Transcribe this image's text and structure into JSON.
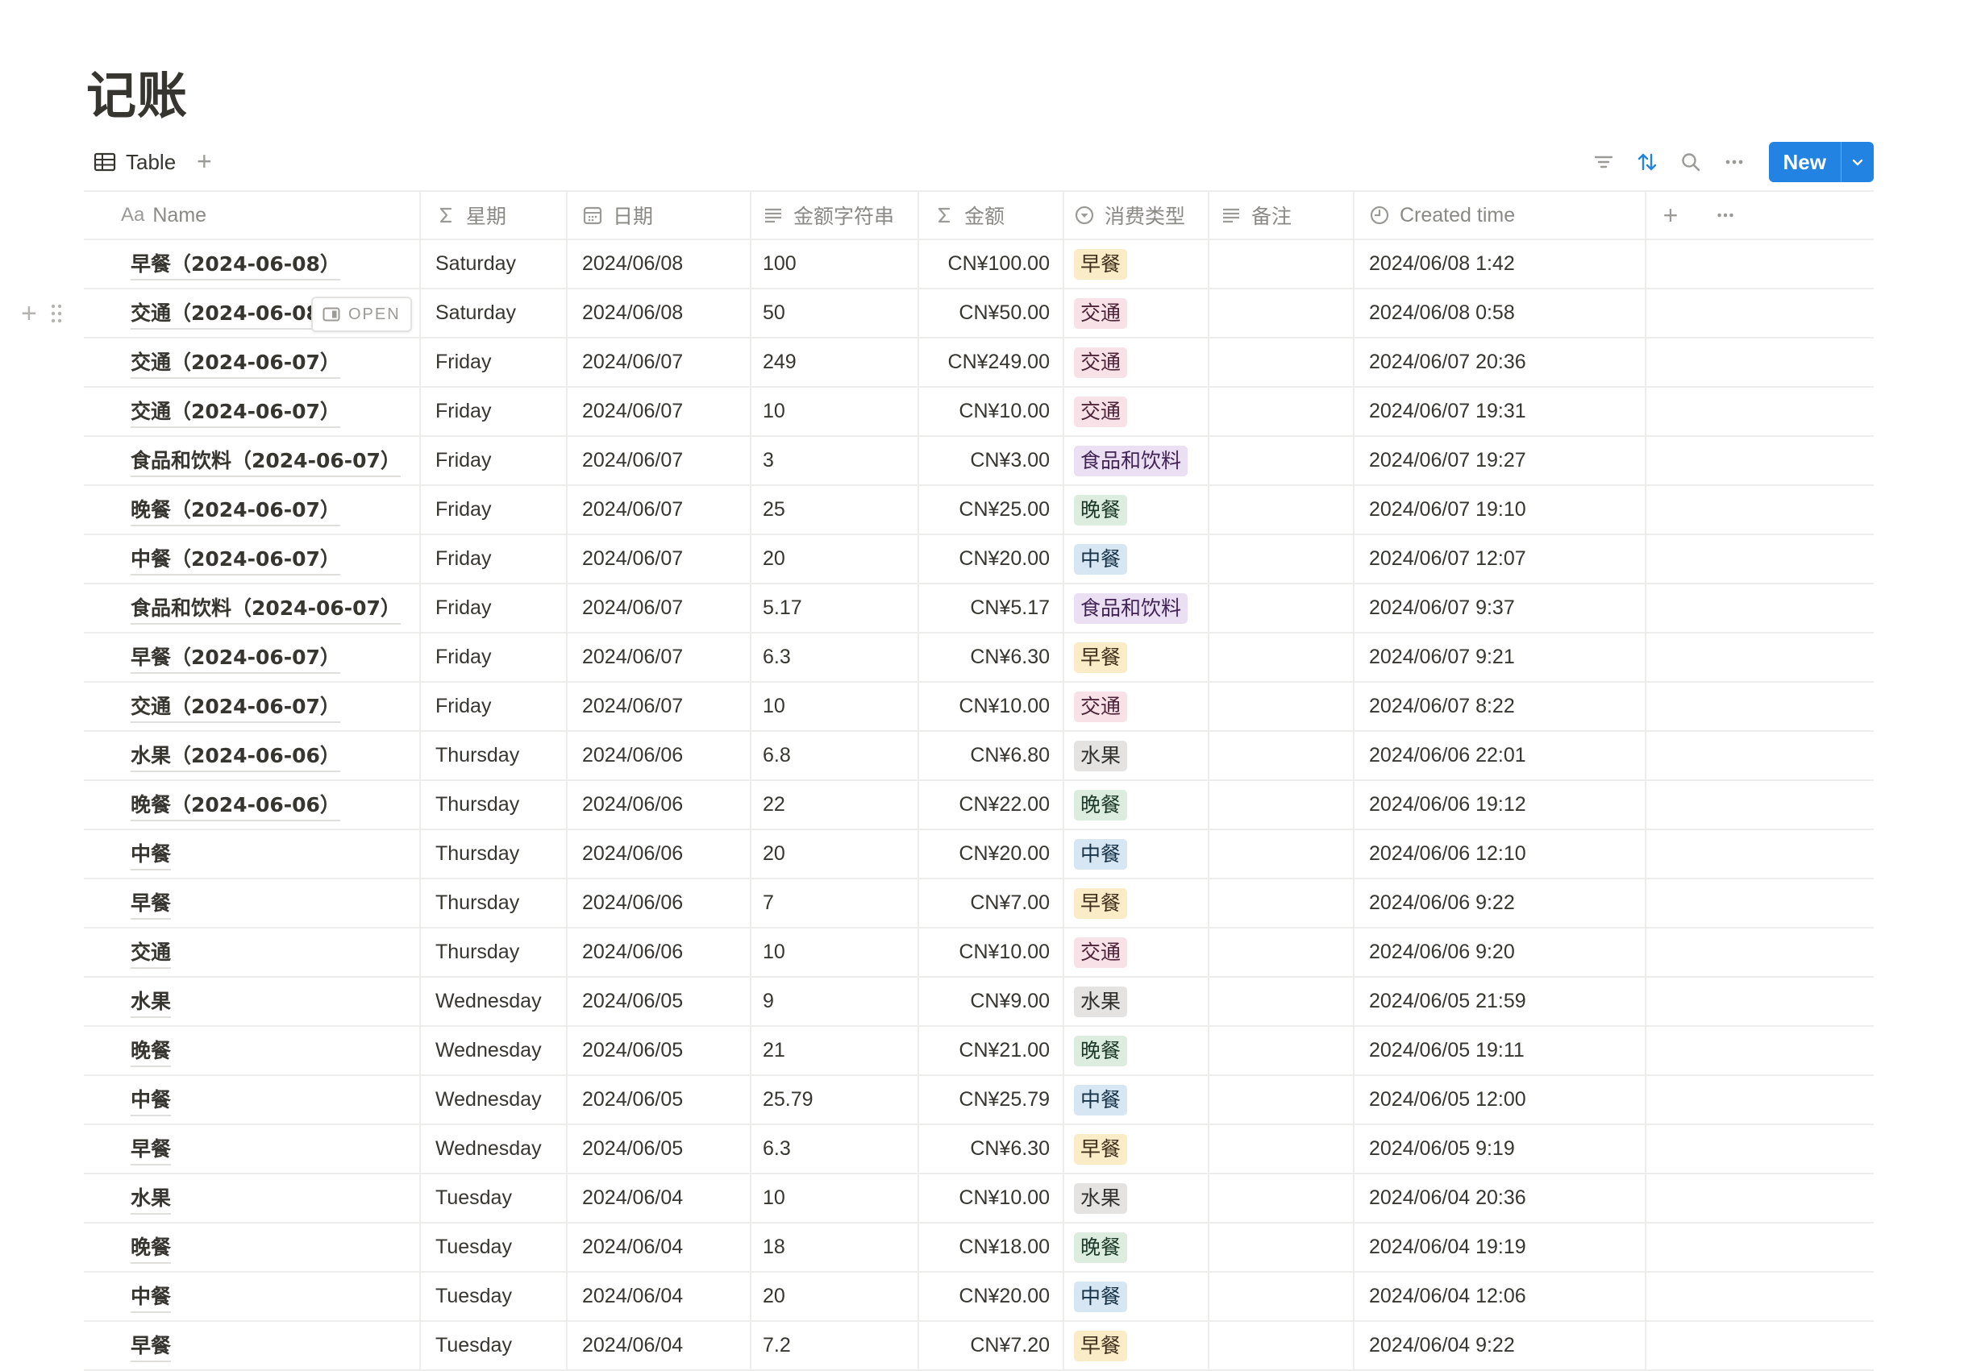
{
  "page": {
    "title": "记账"
  },
  "view": {
    "tab_label": "Table",
    "new_label": "New"
  },
  "row_hover": {
    "open_label": "OPEN"
  },
  "columns": [
    {
      "label": "Name",
      "icon": "text-aa-icon"
    },
    {
      "label": "星期",
      "icon": "sigma-icon"
    },
    {
      "label": "日期",
      "icon": "calendar-icon"
    },
    {
      "label": "金额字符串",
      "icon": "lines-icon"
    },
    {
      "label": "金额",
      "icon": "sigma-icon"
    },
    {
      "label": "消费类型",
      "icon": "select-icon"
    },
    {
      "label": "备注",
      "icon": "lines-icon"
    },
    {
      "label": "Created time",
      "icon": "clock-icon"
    }
  ],
  "column_prefix": "Aa",
  "tag_colors": {
    "早餐": {
      "bg": "#fbecc8",
      "fg": "#40301c"
    },
    "交通": {
      "bg": "#f9e1e8",
      "fg": "#4c2337"
    },
    "食品和饮料": {
      "bg": "#ebdff3",
      "fg": "#412454"
    },
    "晚餐": {
      "bg": "#dcecdf",
      "fg": "#1c3829"
    },
    "中餐": {
      "bg": "#d6e6f2",
      "fg": "#183347"
    },
    "水果": {
      "bg": "#e4e3e1",
      "fg": "#32302c"
    }
  },
  "rows": [
    {
      "name": "早餐（2024-06-08）",
      "weekday": "Saturday",
      "date": "2024/06/08",
      "amount_str": "100",
      "amount": "CN¥100.00",
      "type": "早餐",
      "note": "",
      "created": "2024/06/08 1:42"
    },
    {
      "name": "交通（2024-06-08",
      "weekday": "Saturday",
      "date": "2024/06/08",
      "amount_str": "50",
      "amount": "CN¥50.00",
      "type": "交通",
      "note": "",
      "created": "2024/06/08 0:58",
      "hover": true
    },
    {
      "name": "交通（2024-06-07）",
      "weekday": "Friday",
      "date": "2024/06/07",
      "amount_str": "249",
      "amount": "CN¥249.00",
      "type": "交通",
      "note": "",
      "created": "2024/06/07 20:36"
    },
    {
      "name": "交通（2024-06-07）",
      "weekday": "Friday",
      "date": "2024/06/07",
      "amount_str": "10",
      "amount": "CN¥10.00",
      "type": "交通",
      "note": "",
      "created": "2024/06/07 19:31"
    },
    {
      "name": "食品和饮料（2024-06-07）",
      "weekday": "Friday",
      "date": "2024/06/07",
      "amount_str": "3",
      "amount": "CN¥3.00",
      "type": "食品和饮料",
      "note": "",
      "created": "2024/06/07 19:27"
    },
    {
      "name": "晚餐（2024-06-07）",
      "weekday": "Friday",
      "date": "2024/06/07",
      "amount_str": "25",
      "amount": "CN¥25.00",
      "type": "晚餐",
      "note": "",
      "created": "2024/06/07 19:10"
    },
    {
      "name": "中餐（2024-06-07）",
      "weekday": "Friday",
      "date": "2024/06/07",
      "amount_str": "20",
      "amount": "CN¥20.00",
      "type": "中餐",
      "note": "",
      "created": "2024/06/07 12:07"
    },
    {
      "name": "食品和饮料（2024-06-07）",
      "weekday": "Friday",
      "date": "2024/06/07",
      "amount_str": "5.17",
      "amount": "CN¥5.17",
      "type": "食品和饮料",
      "note": "",
      "created": "2024/06/07 9:37"
    },
    {
      "name": "早餐（2024-06-07）",
      "weekday": "Friday",
      "date": "2024/06/07",
      "amount_str": "6.3",
      "amount": "CN¥6.30",
      "type": "早餐",
      "note": "",
      "created": "2024/06/07 9:21"
    },
    {
      "name": "交通（2024-06-07）",
      "weekday": "Friday",
      "date": "2024/06/07",
      "amount_str": "10",
      "amount": "CN¥10.00",
      "type": "交通",
      "note": "",
      "created": "2024/06/07 8:22"
    },
    {
      "name": "水果（2024-06-06）",
      "weekday": "Thursday",
      "date": "2024/06/06",
      "amount_str": "6.8",
      "amount": "CN¥6.80",
      "type": "水果",
      "note": "",
      "created": "2024/06/06 22:01"
    },
    {
      "name": "晚餐（2024-06-06）",
      "weekday": "Thursday",
      "date": "2024/06/06",
      "amount_str": "22",
      "amount": "CN¥22.00",
      "type": "晚餐",
      "note": "",
      "created": "2024/06/06 19:12"
    },
    {
      "name": "中餐",
      "weekday": "Thursday",
      "date": "2024/06/06",
      "amount_str": "20",
      "amount": "CN¥20.00",
      "type": "中餐",
      "note": "",
      "created": "2024/06/06 12:10"
    },
    {
      "name": "早餐",
      "weekday": "Thursday",
      "date": "2024/06/06",
      "amount_str": "7",
      "amount": "CN¥7.00",
      "type": "早餐",
      "note": "",
      "created": "2024/06/06 9:22"
    },
    {
      "name": "交通",
      "weekday": "Thursday",
      "date": "2024/06/06",
      "amount_str": "10",
      "amount": "CN¥10.00",
      "type": "交通",
      "note": "",
      "created": "2024/06/06 9:20"
    },
    {
      "name": "水果",
      "weekday": "Wednesday",
      "date": "2024/06/05",
      "amount_str": "9",
      "amount": "CN¥9.00",
      "type": "水果",
      "note": "",
      "created": "2024/06/05 21:59"
    },
    {
      "name": "晚餐",
      "weekday": "Wednesday",
      "date": "2024/06/05",
      "amount_str": "21",
      "amount": "CN¥21.00",
      "type": "晚餐",
      "note": "",
      "created": "2024/06/05 19:11"
    },
    {
      "name": "中餐",
      "weekday": "Wednesday",
      "date": "2024/06/05",
      "amount_str": "25.79",
      "amount": "CN¥25.79",
      "type": "中餐",
      "note": "",
      "created": "2024/06/05 12:00"
    },
    {
      "name": "早餐",
      "weekday": "Wednesday",
      "date": "2024/06/05",
      "amount_str": "6.3",
      "amount": "CN¥6.30",
      "type": "早餐",
      "note": "",
      "created": "2024/06/05 9:19"
    },
    {
      "name": "水果",
      "weekday": "Tuesday",
      "date": "2024/06/04",
      "amount_str": "10",
      "amount": "CN¥10.00",
      "type": "水果",
      "note": "",
      "created": "2024/06/04 20:36"
    },
    {
      "name": "晚餐",
      "weekday": "Tuesday",
      "date": "2024/06/04",
      "amount_str": "18",
      "amount": "CN¥18.00",
      "type": "晚餐",
      "note": "",
      "created": "2024/06/04 19:19"
    },
    {
      "name": "中餐",
      "weekday": "Tuesday",
      "date": "2024/06/04",
      "amount_str": "20",
      "amount": "CN¥20.00",
      "type": "中餐",
      "note": "",
      "created": "2024/06/04 12:06"
    },
    {
      "name": "早餐",
      "weekday": "Tuesday",
      "date": "2024/06/04",
      "amount_str": "7.2",
      "amount": "CN¥7.20",
      "type": "早餐",
      "note": "",
      "created": "2024/06/04 9:22"
    }
  ]
}
